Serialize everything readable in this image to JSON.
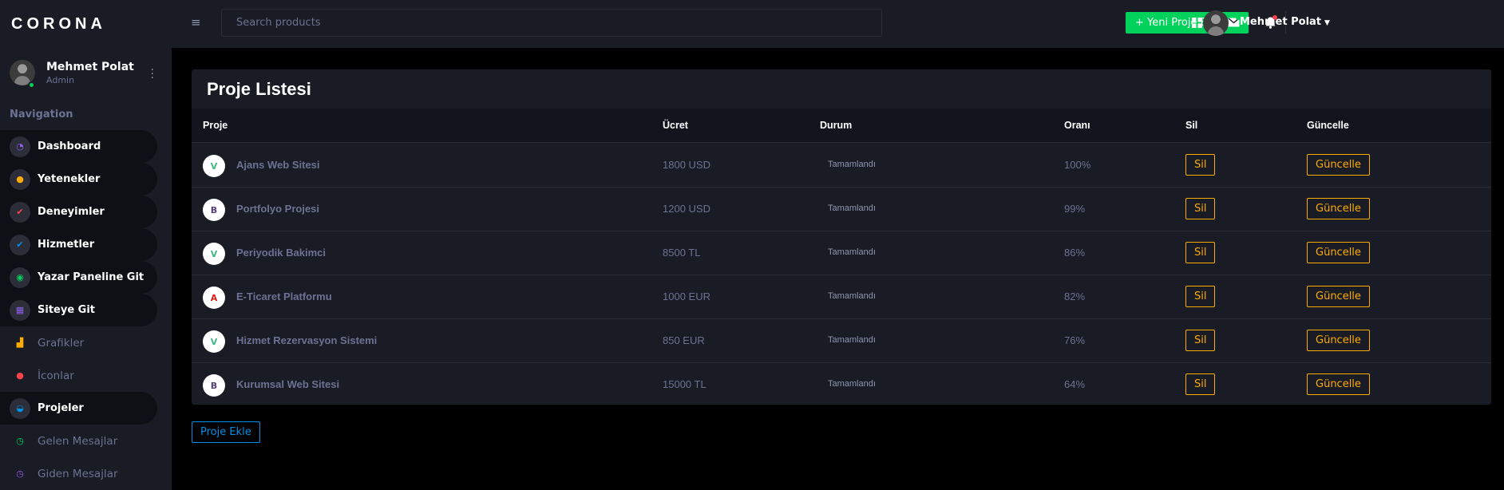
{
  "brand": "CORONA",
  "profile": {
    "name": "Mehmet Polat",
    "role": "Admin"
  },
  "nav": {
    "title": "Navigation",
    "items": [
      {
        "label": "Dashboard",
        "icon": "speedometer-icon",
        "glyph": "◔",
        "color": "#8f5fe8"
      },
      {
        "label": "Yetenekler",
        "icon": "skills-icon",
        "glyph": "●",
        "color": "#ffab00"
      },
      {
        "label": "Deneyimler",
        "icon": "check-circle-icon",
        "glyph": "✔",
        "color": "#fc424a"
      },
      {
        "label": "Hizmetler",
        "icon": "check-icon",
        "glyph": "✔",
        "color": "#0090e7"
      },
      {
        "label": "Yazar Paneline Git",
        "icon": "eye-icon",
        "glyph": "◉",
        "color": "#00d25b"
      },
      {
        "label": "Siteye Git",
        "icon": "grid-icon",
        "glyph": "▦",
        "color": "#8f5fe8"
      },
      {
        "label": "Grafikler",
        "icon": "chart-icon",
        "glyph": "▟",
        "color": "#ffab00"
      },
      {
        "label": "İconlar",
        "icon": "pin-icon",
        "glyph": "●",
        "color": "#fc424a"
      },
      {
        "label": "Projeler",
        "icon": "github-icon",
        "glyph": "◒",
        "color": "#0090e7"
      },
      {
        "label": "Gelen Mesajlar",
        "icon": "clock-icon",
        "glyph": "◷",
        "color": "#00d25b"
      },
      {
        "label": "Giden Mesajlar",
        "icon": "clock-icon",
        "glyph": "◷",
        "color": "#8f5fe8"
      }
    ]
  },
  "topbar": {
    "search_placeholder": "Search products",
    "new_project_label": "+ Yeni Proje Ekleme",
    "user_name": "Mehmet Polat"
  },
  "table": {
    "title": "Proje Listesi",
    "headers": [
      "Proje",
      "Ücret",
      "Durum",
      "Oranı",
      "Sil",
      "Güncelle"
    ],
    "rows": [
      {
        "icon": "vue-icon",
        "glyph": "V",
        "icon_color": "#41b883",
        "name": "Ajans Web Sitesi",
        "price": "1800 USD",
        "status": "Tamamlandı",
        "ratio": "100%",
        "delete": "Sil",
        "update": "Güncelle"
      },
      {
        "icon": "bootstrap-icon",
        "glyph": "B",
        "icon_color": "#563d7c",
        "name": "Portfolyo Projesi",
        "price": "1200 USD",
        "status": "Tamamlandı",
        "ratio": "99%",
        "delete": "Sil",
        "update": "Güncelle"
      },
      {
        "icon": "vue-icon",
        "glyph": "V",
        "icon_color": "#41b883",
        "name": "Periyodik Bakimci",
        "price": "8500 TL",
        "status": "Tamamlandı",
        "ratio": "86%",
        "delete": "Sil",
        "update": "Güncelle"
      },
      {
        "icon": "angular-icon",
        "glyph": "A",
        "icon_color": "#dd1b16",
        "name": "E-Ticaret Platformu",
        "price": "1000 EUR",
        "status": "Tamamlandı",
        "ratio": "82%",
        "delete": "Sil",
        "update": "Güncelle"
      },
      {
        "icon": "vue-icon",
        "glyph": "V",
        "icon_color": "#41b883",
        "name": "Hizmet Rezervasyon Sistemi",
        "price": "850 EUR",
        "status": "Tamamlandı",
        "ratio": "76%",
        "delete": "Sil",
        "update": "Güncelle"
      },
      {
        "icon": "bootstrap-icon",
        "glyph": "B",
        "icon_color": "#563d7c",
        "name": "Kurumsal Web Sitesi",
        "price": "15000 TL",
        "status": "Tamamlandı",
        "ratio": "64%",
        "delete": "Sil",
        "update": "Güncelle"
      }
    ]
  },
  "add_project_label": "Proje Ekle"
}
